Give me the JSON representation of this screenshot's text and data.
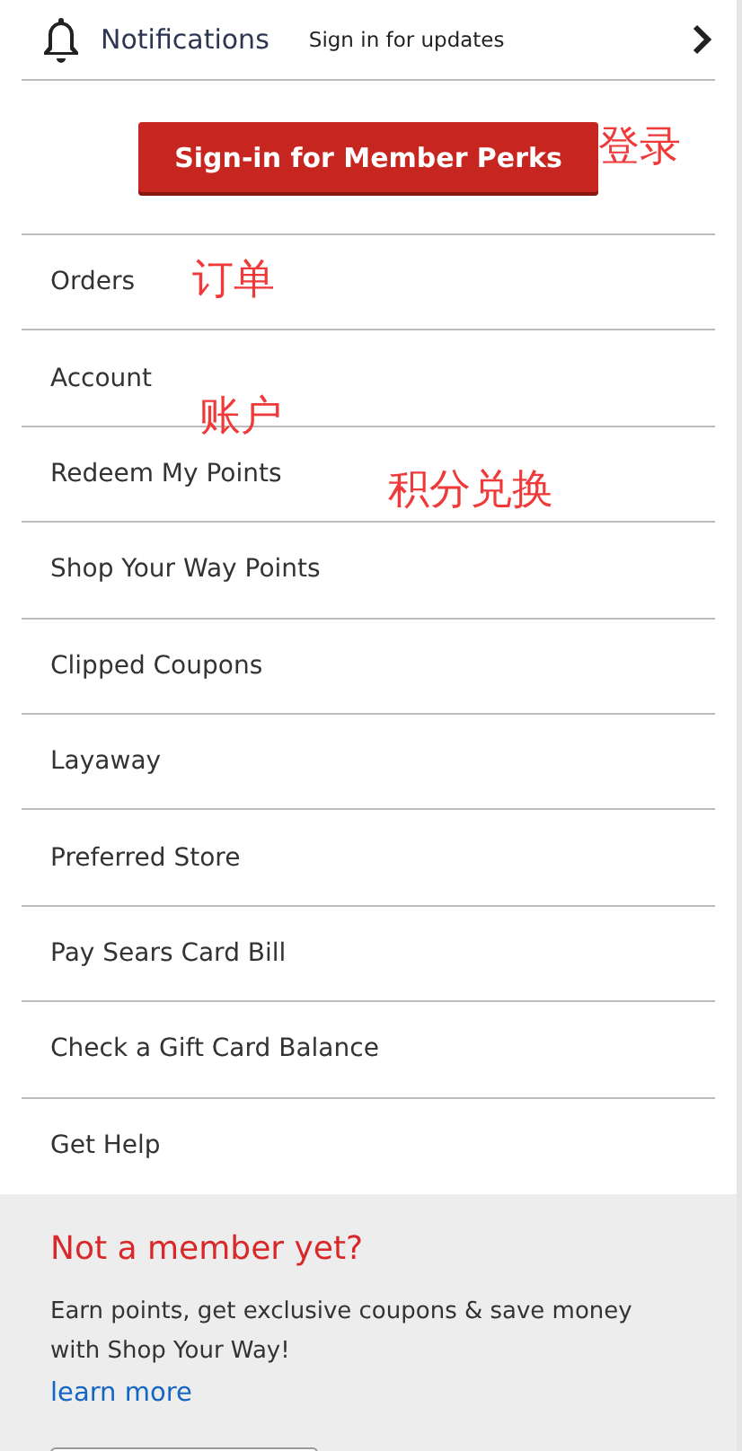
{
  "header": {
    "title": "Notifications",
    "subtitle": "Sign in for updates"
  },
  "signin_button": "Sign-in for Member Perks",
  "menu": [
    {
      "label": "Orders"
    },
    {
      "label": "Account"
    },
    {
      "label": "Redeem My Points"
    },
    {
      "label": "Shop Your Way Points"
    },
    {
      "label": "Clipped Coupons"
    },
    {
      "label": "Layaway"
    },
    {
      "label": "Preferred Store"
    },
    {
      "label": "Pay Sears Card Bill"
    },
    {
      "label": "Check a Gift Card Balance"
    },
    {
      "label": "Get Help"
    }
  ],
  "promo": {
    "title": "Not a member yet?",
    "text": "Earn points, get exclusive coupons & save money with Shop Your Way!",
    "link": "learn more"
  },
  "annotations": [
    {
      "text": "登录"
    },
    {
      "text": "订单"
    },
    {
      "text": "账户"
    },
    {
      "text": "积分兑换"
    }
  ]
}
